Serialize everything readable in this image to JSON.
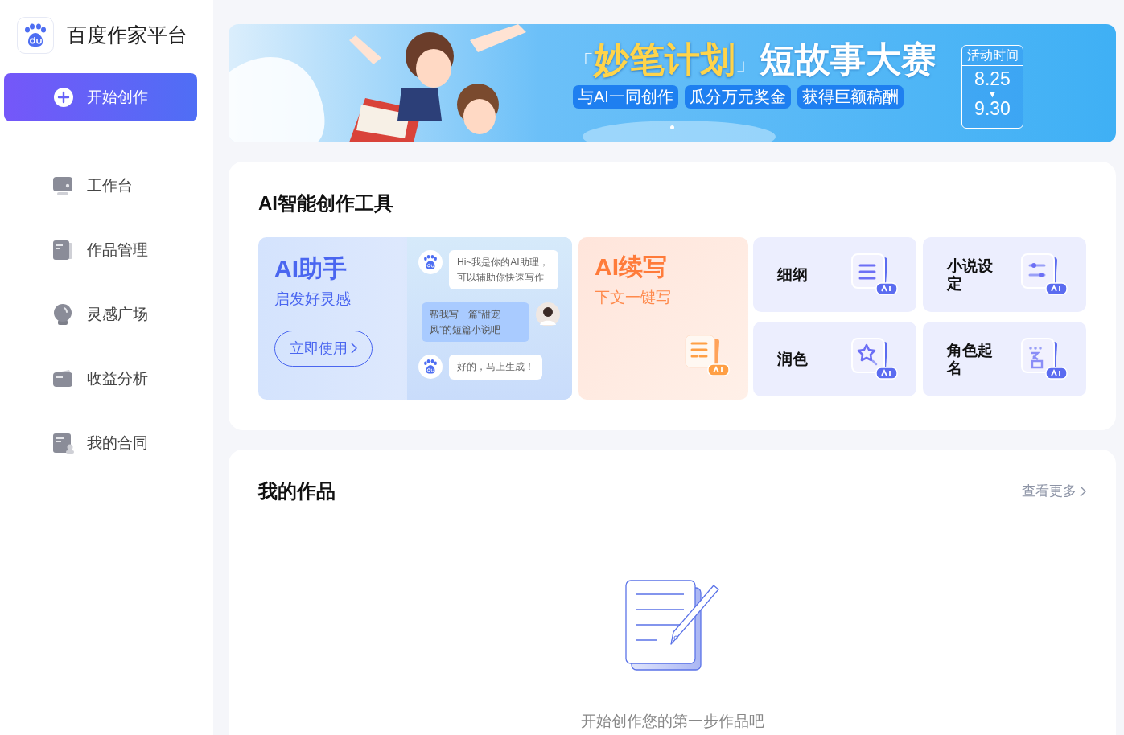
{
  "sidebar": {
    "logo_text": "百度作家平台",
    "create_button": "开始创作",
    "items": [
      {
        "label": "工作台",
        "kind": "desk"
      },
      {
        "label": "作品管理",
        "kind": "book"
      },
      {
        "label": "灵感广场",
        "kind": "bulb"
      },
      {
        "label": "收益分析",
        "kind": "wallet"
      },
      {
        "label": "我的合同",
        "kind": "contract"
      }
    ]
  },
  "banner": {
    "kind": "picture",
    "bracket_open": "「",
    "title_highlight": "妙笔计划",
    "bracket_close": "」",
    "title": "短故事大赛",
    "tags": [
      "与AI一同创作",
      "瓜分万元奖金",
      "获得巨额稿酬"
    ],
    "period_label": "活动时间",
    "start": "8.25",
    "arrow": "▼",
    "end": "9.30"
  },
  "tools": {
    "title": "AI智能创作工具",
    "assistant": {
      "title": "AI助手",
      "subtitle": "启发好灵感",
      "button": "立即使用",
      "messages": [
        {
          "kind": "bot",
          "text": "Hi~我是你的AI助理，可以辅助你快速写作"
        },
        {
          "kind": "user",
          "text": "帮我写一篇“甜宠风”的短篇小说吧"
        },
        {
          "kind": "bot",
          "text": "好的，马上生成！"
        }
      ]
    },
    "continue": {
      "title": "AI续写",
      "subtitle": "下文一键写"
    },
    "items": [
      {
        "label": "细纲",
        "kind": "outline"
      },
      {
        "label": "小说设定",
        "kind": "settings"
      },
      {
        "label": "润色",
        "kind": "polish"
      },
      {
        "label": "角色起名",
        "kind": "naming"
      }
    ]
  },
  "works": {
    "title": "我的作品",
    "more_link": "查看更多",
    "empty_text": "开始创作您的第一步作品吧"
  }
}
